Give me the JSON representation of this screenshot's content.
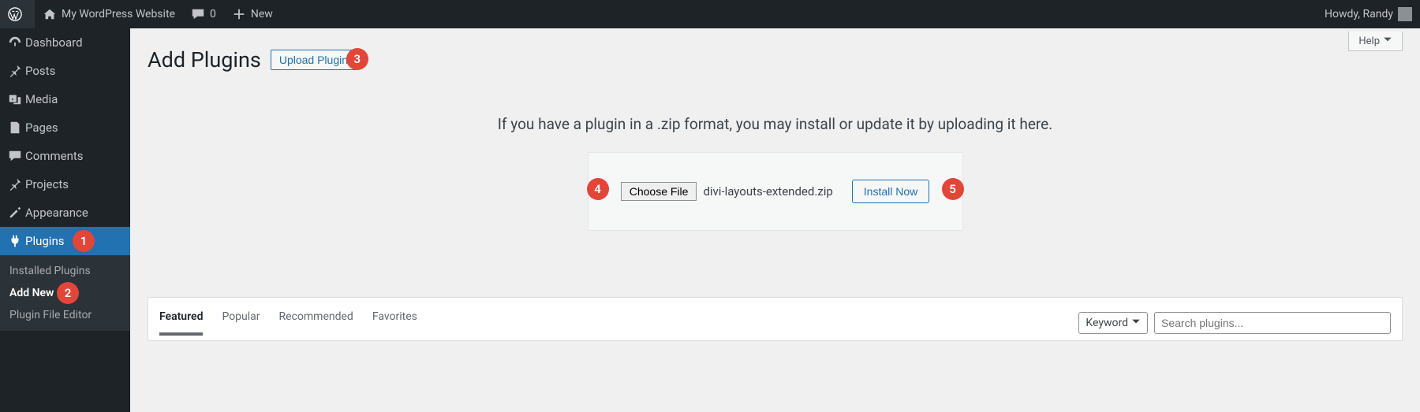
{
  "adminbar": {
    "site_name": "My WordPress Website",
    "comments_count": "0",
    "new_label": "New",
    "greeting": "Howdy, Randy"
  },
  "sidebar": {
    "dashboard": "Dashboard",
    "posts": "Posts",
    "media": "Media",
    "pages": "Pages",
    "comments": "Comments",
    "projects": "Projects",
    "appearance": "Appearance",
    "plugins": "Plugins",
    "plugins_submenu": {
      "installed": "Installed Plugins",
      "add_new": "Add New",
      "editor": "Plugin File Editor"
    }
  },
  "page": {
    "help_label": "Help",
    "title": "Add Plugins",
    "upload_btn": "Upload Plugin",
    "upload_hint": "If you have a plugin in a .zip format, you may install or update it by uploading it here.",
    "choose_file": "Choose File",
    "filename": "divi-layouts-extended.zip",
    "install_now": "Install Now",
    "tabs": {
      "featured": "Featured",
      "popular": "Popular",
      "recommended": "Recommended",
      "favorites": "Favorites"
    },
    "search_type": "Keyword",
    "search_placeholder": "Search plugins..."
  },
  "annotations": {
    "a1": "1",
    "a2": "2",
    "a3": "3",
    "a4": "4",
    "a5": "5"
  }
}
